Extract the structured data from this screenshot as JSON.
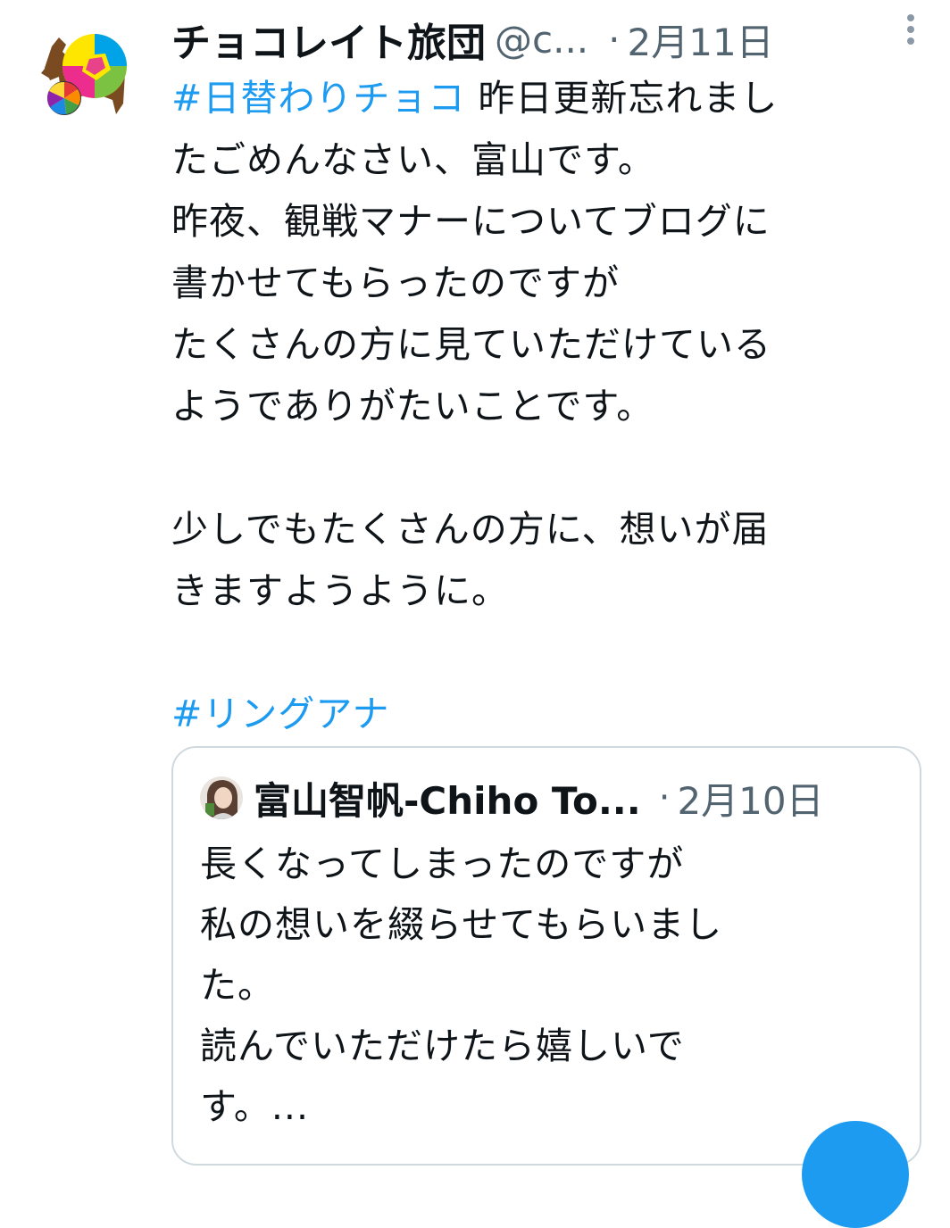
{
  "tweet": {
    "display_name": "チョコレイト旅団",
    "handle": "@c...",
    "separator": "·",
    "timestamp": "2月11日",
    "body_lines": [
      {
        "hashtag": "#日替わりチョコ",
        "text": " 昨日更新忘れまし"
      },
      {
        "text": "たごめんなさい、富山です。"
      },
      {
        "text": "昨夜、観戦マナーについてブログに"
      },
      {
        "text": "書かせてもらったのですが"
      },
      {
        "text": "たくさんの方に見ていただけている"
      },
      {
        "text": "ようでありがたいことです。"
      },
      {
        "text": ""
      },
      {
        "text": "少しでもたくさんの方に、想いが届"
      },
      {
        "text": "きますようように。"
      },
      {
        "text": ""
      },
      {
        "hashtag": "#リングアナ",
        "text": ""
      }
    ]
  },
  "quoted_tweet": {
    "display_name": "富山智帆-Chiho To...",
    "separator": "·",
    "timestamp": "2月10日",
    "body_lines": [
      "長くなってしまったのですが",
      "私の想いを綴らせてもらいまし",
      "た。",
      "読んでいただけたら嬉しいで",
      "す。..."
    ]
  },
  "colors": {
    "accent": "#1d9bf0",
    "text": "#0f1419",
    "secondary_text": "#536471",
    "border": "#cfd9de"
  },
  "icons": {
    "more": "more-vertical-icon",
    "compose": "compose-fab-icon"
  }
}
